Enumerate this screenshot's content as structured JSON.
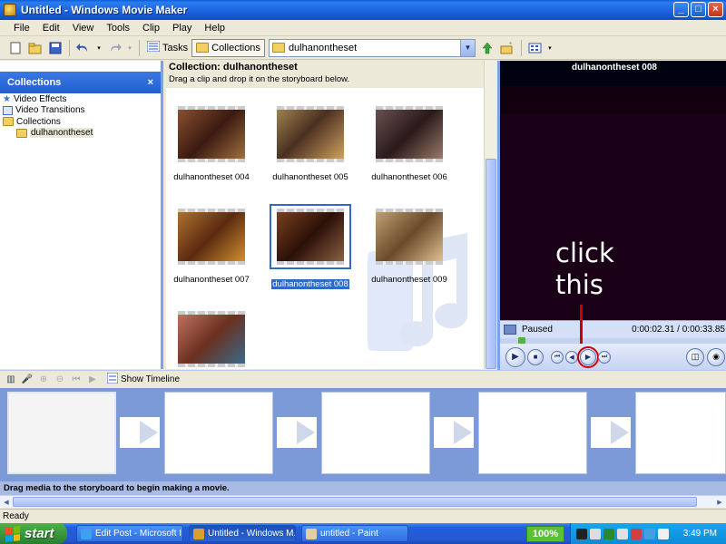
{
  "window": {
    "title": "Untitled - Windows Movie Maker",
    "buttons": [
      "_",
      "□",
      "×"
    ]
  },
  "menu": [
    "File",
    "Edit",
    "View",
    "Tools",
    "Clip",
    "Play",
    "Help"
  ],
  "toolbar": {
    "tasks_label": "Tasks",
    "collections_label": "Collections",
    "collection_select_value": "dulhanontheset"
  },
  "left_panel": {
    "header": "Collections",
    "close": "×",
    "items": [
      {
        "label": "Video Effects",
        "icon": "star-icon"
      },
      {
        "label": "Video Transitions",
        "icon": "transition-icon"
      },
      {
        "label": "Collections",
        "icon": "folder-icon"
      },
      {
        "label": "dulhanontheset",
        "icon": "folder-icon"
      }
    ]
  },
  "collection": {
    "title": "Collection: dulhanontheset",
    "subtitle": "Drag a clip and drop it on the storyboard below.",
    "clips": [
      {
        "name": "dulhanontheset 004",
        "selected": false,
        "tint": "#5b2e1c"
      },
      {
        "name": "dulhanontheset 005",
        "selected": false,
        "tint": "#6a4a26"
      },
      {
        "name": "dulhanontheset 006",
        "selected": false,
        "tint": "#3b2a2a"
      },
      {
        "name": "dulhanontheset 007",
        "selected": false,
        "tint": "#6a3e1a"
      },
      {
        "name": "dulhanontheset 008",
        "selected": true,
        "tint": "#4a2412"
      },
      {
        "name": "dulhanontheset 009",
        "selected": false,
        "tint": "#7a5a3a"
      },
      {
        "name": "",
        "selected": false,
        "tint": "#8a4a3a"
      }
    ]
  },
  "monitor": {
    "title": "dulhanontheset 008",
    "status": "Paused",
    "time": "0:00:02.31 / 0:00:33.85"
  },
  "annotation": {
    "line1": "click",
    "line2": "this",
    "color": "#c80000"
  },
  "storyboard": {
    "toolbar_label": "Show Timeline",
    "message": "Drag media to the storyboard to begin making a movie."
  },
  "status_bar": "Ready",
  "taskbar": {
    "start": "start",
    "tasks": [
      {
        "label": "Edit Post - Microsoft I...",
        "active": false
      },
      {
        "label": "Untitled - Windows M...",
        "active": true
      },
      {
        "label": "untitled - Paint",
        "active": false
      }
    ],
    "zoom": "100%",
    "clock": "3:49 PM"
  }
}
